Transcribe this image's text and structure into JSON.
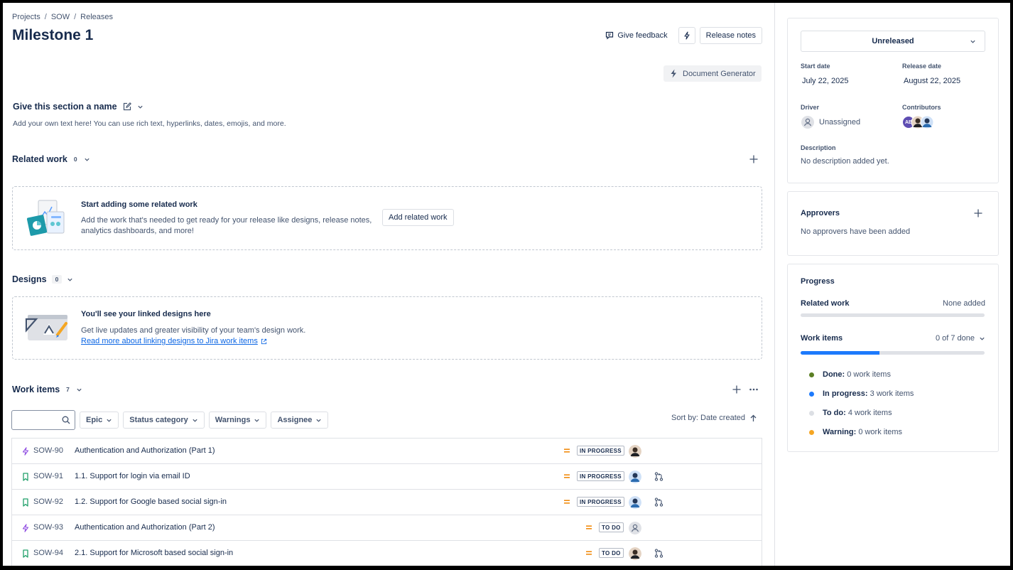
{
  "breadcrumb": {
    "items": [
      "Projects",
      "SOW",
      "Releases"
    ],
    "sep": "/"
  },
  "title": "Milestone 1",
  "header": {
    "feedback_label": "Give feedback",
    "release_notes_label": "Release notes"
  },
  "doc_generator_label": "Document Generator",
  "custom_section": {
    "name": "Give this section a name",
    "text": "Add your own text here! You can use rich text, hyperlinks, dates, emojis, and more."
  },
  "related_work": {
    "title": "Related work",
    "count": "0",
    "empty_heading": "Start adding some related work",
    "empty_line1": "Add the work that's needed to get ready for your release like designs, release notes,",
    "empty_line2": "analytics dashboards, and more!",
    "add_button": "Add related work"
  },
  "designs": {
    "title": "Designs",
    "count": "0",
    "empty_heading": "You'll see your linked designs here",
    "empty_text": "Get live updates and greater visibility of your team's design work.",
    "link_text": "Read more about linking designs to Jira work items"
  },
  "work_items": {
    "title": "Work items",
    "count": "7",
    "filters": [
      "Epic",
      "Status category",
      "Warnings",
      "Assignee"
    ],
    "sort_label": "Sort by: Date created",
    "rows": [
      {
        "type": "epic",
        "key": "SOW-90",
        "summary": "Authentication and Authorization (Part 1)",
        "status": "IN PROGRESS",
        "assignee": "person",
        "has_pr": false
      },
      {
        "type": "story",
        "key": "SOW-91",
        "summary": "1.1. Support for login via email ID",
        "status": "IN PROGRESS",
        "assignee": "blue-person",
        "has_pr": true
      },
      {
        "type": "story",
        "key": "SOW-92",
        "summary": "1.2. Support for Google based social sign-in",
        "status": "IN PROGRESS",
        "assignee": "blue-person",
        "has_pr": true
      },
      {
        "type": "epic",
        "key": "SOW-93",
        "summary": "Authentication and Authorization (Part 2)",
        "status": "TO DO",
        "assignee": "unassigned",
        "has_pr": false
      },
      {
        "type": "story",
        "key": "SOW-94",
        "summary": "2.1. Support for Microsoft based social sign-in",
        "status": "TO DO",
        "assignee": "person",
        "has_pr": true
      }
    ]
  },
  "details": {
    "status": "Unreleased",
    "start_date_label": "Start date",
    "start_date": "July 22, 2025",
    "release_date_label": "Release date",
    "release_date": "August 22, 2025",
    "driver_label": "Driver",
    "driver": "Unassigned",
    "contributors_label": "Contributors",
    "contributor_initials": "AB",
    "description_label": "Description",
    "description": "No description added yet."
  },
  "approvers": {
    "title": "Approvers",
    "empty": "No approvers have been added"
  },
  "progress": {
    "title": "Progress",
    "related_work_label": "Related work",
    "related_work_value": "None added",
    "work_items_label": "Work items",
    "work_items_value": "0 of 7 done",
    "in_progress_fraction": 0.4286,
    "legend": [
      {
        "label": "Done:",
        "value": "0 work items",
        "color": "#5b7f24"
      },
      {
        "label": "In progress:",
        "value": "3 work items",
        "color": "#1d7afc"
      },
      {
        "label": "To do:",
        "value": "4 work items",
        "color": "#dcdfe4"
      },
      {
        "label": "Warning:",
        "value": "0 work items",
        "color": "#f5a623"
      }
    ]
  }
}
